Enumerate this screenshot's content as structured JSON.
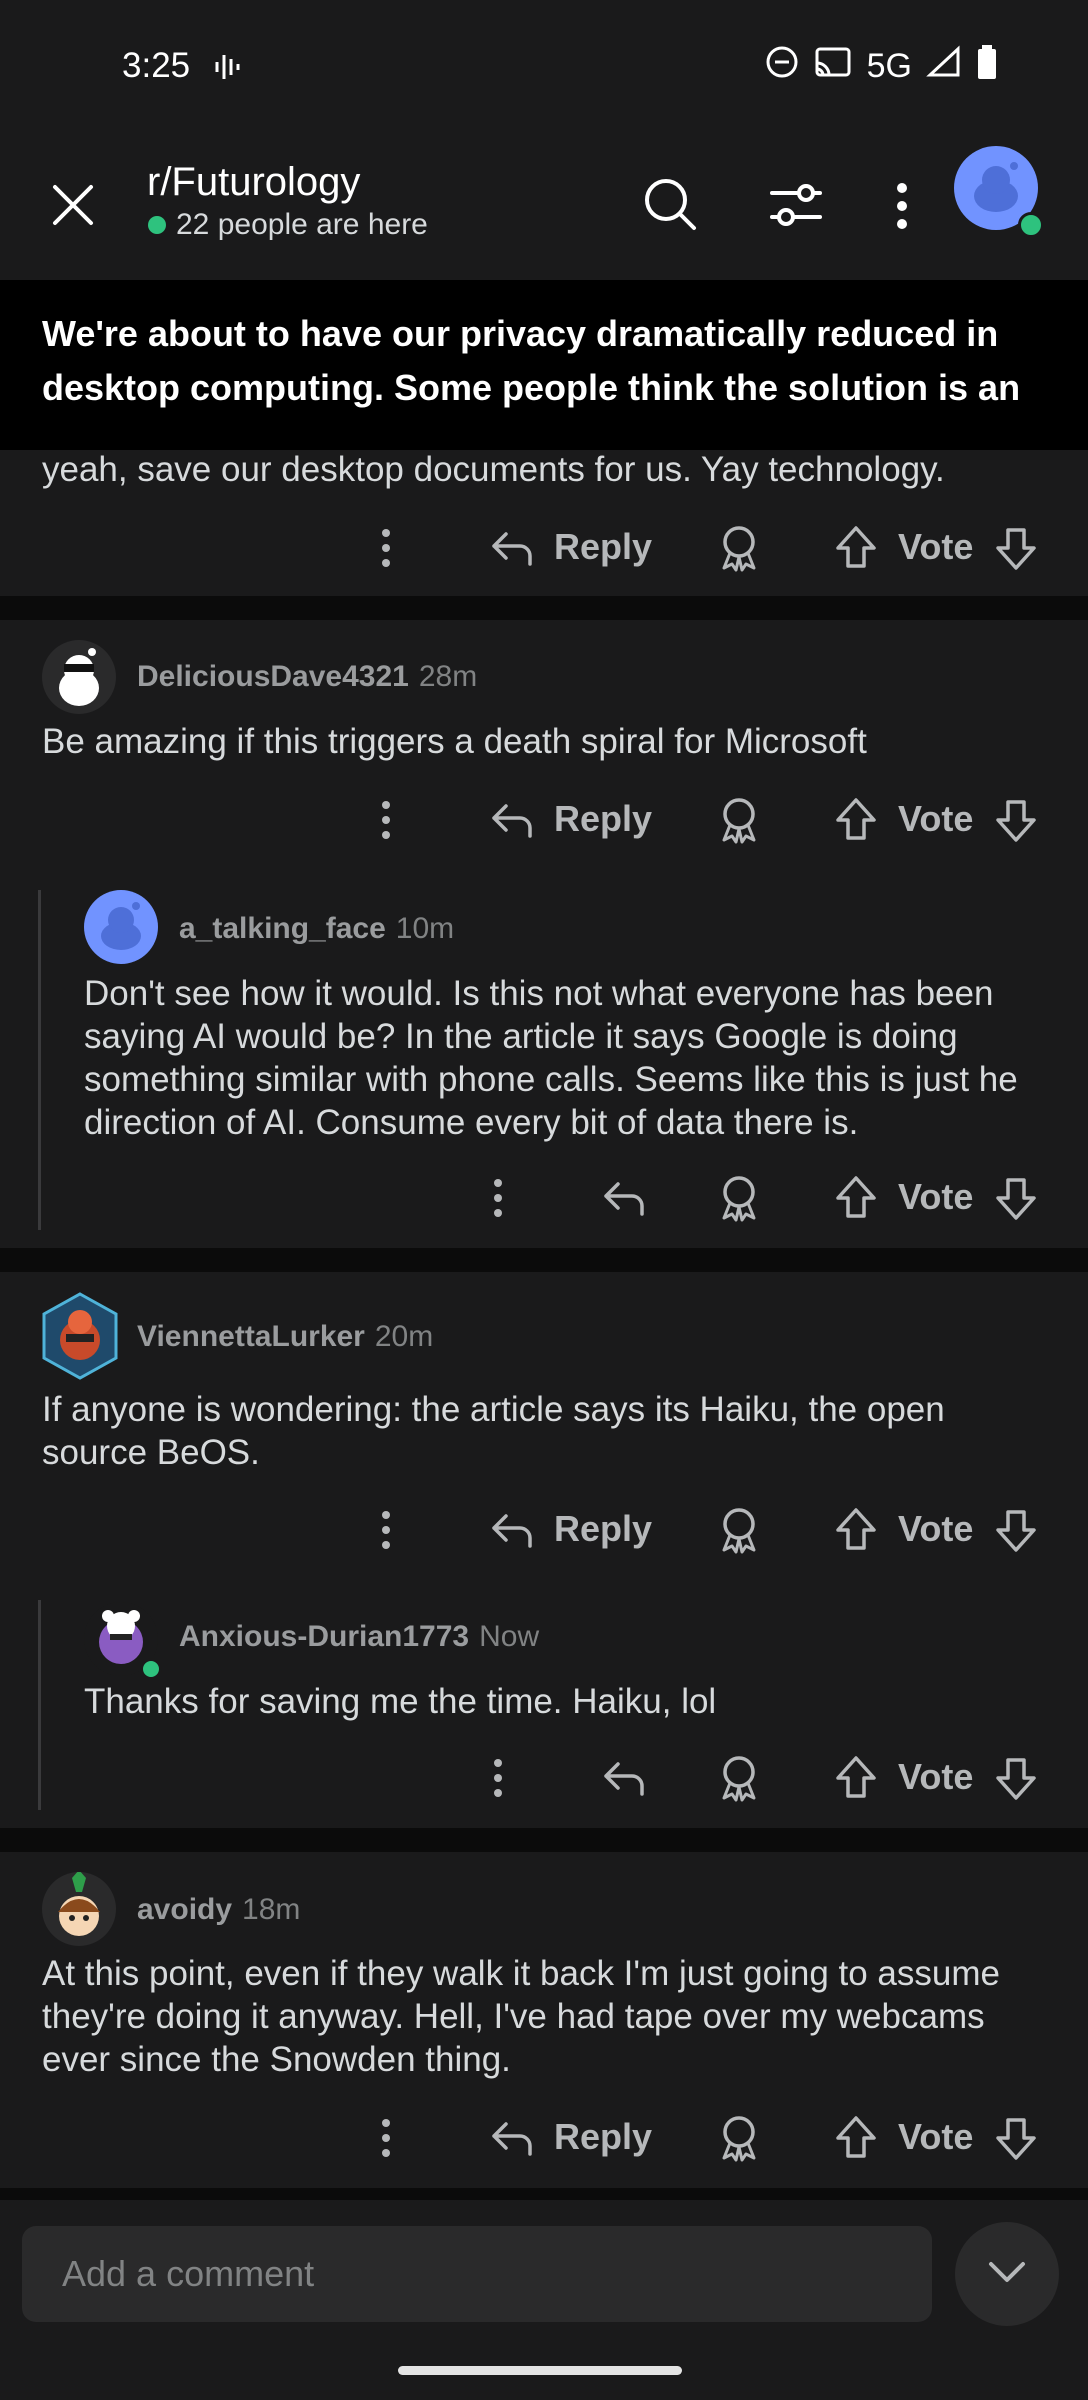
{
  "status_bar": {
    "time": "3:25",
    "network": "5G"
  },
  "header": {
    "subreddit": "r/Futurology",
    "online_text": "22 people are here"
  },
  "post": {
    "title": "We're about to have our privacy dramatically reduced in desktop computing. Some people think the solution is an op..."
  },
  "comments": [
    {
      "text": "yeah, save our desktop documents for us. Yay technology.",
      "actions": {
        "reply": "Reply",
        "vote": "Vote"
      }
    },
    {
      "username": "DeliciousDave4321",
      "time": "28m",
      "text": "Be amazing if this triggers a death spiral for Microsoft",
      "actions": {
        "reply": "Reply",
        "vote": "Vote"
      }
    },
    {
      "username": "a_talking_face",
      "time": "10m",
      "text": "Don't see how it would. Is this not what everyone has been saying AI would be? In the article it says Google is doing something similar with phone calls. Seems like this is just he direction of AI. Consume every bit of data there is.",
      "actions": {
        "vote": "Vote"
      }
    },
    {
      "username": "ViennettaLurker",
      "time": "20m",
      "text": "If anyone is wondering: the article says its Haiku, the open source BeOS.",
      "actions": {
        "reply": "Reply",
        "vote": "Vote"
      }
    },
    {
      "username": "Anxious-Durian1773",
      "time": "Now",
      "text": "Thanks for saving me the time. Haiku, lol",
      "actions": {
        "vote": "Vote"
      }
    },
    {
      "username": "avoidy",
      "time": "18m",
      "text": "At this point, even if they walk it back I'm just going to assume they're doing it anyway. Hell, I've had tape over my webcams ever since the Snowden thing.",
      "actions": {
        "reply": "Reply",
        "vote": "Vote"
      }
    }
  ],
  "composer": {
    "placeholder": "Add a comment"
  },
  "icons": {
    "close": "close-icon",
    "search": "search-icon",
    "filter": "filter-icon",
    "more": "more-vert-icon",
    "reply": "reply-icon",
    "award": "award-icon",
    "upvote": "upvote-icon",
    "downvote": "downvote-icon"
  },
  "colors": {
    "background": "#0b0b0b",
    "card": "#1a1a1b",
    "online_dot": "#2ec27e",
    "avatar_blue": "#7193ff"
  }
}
